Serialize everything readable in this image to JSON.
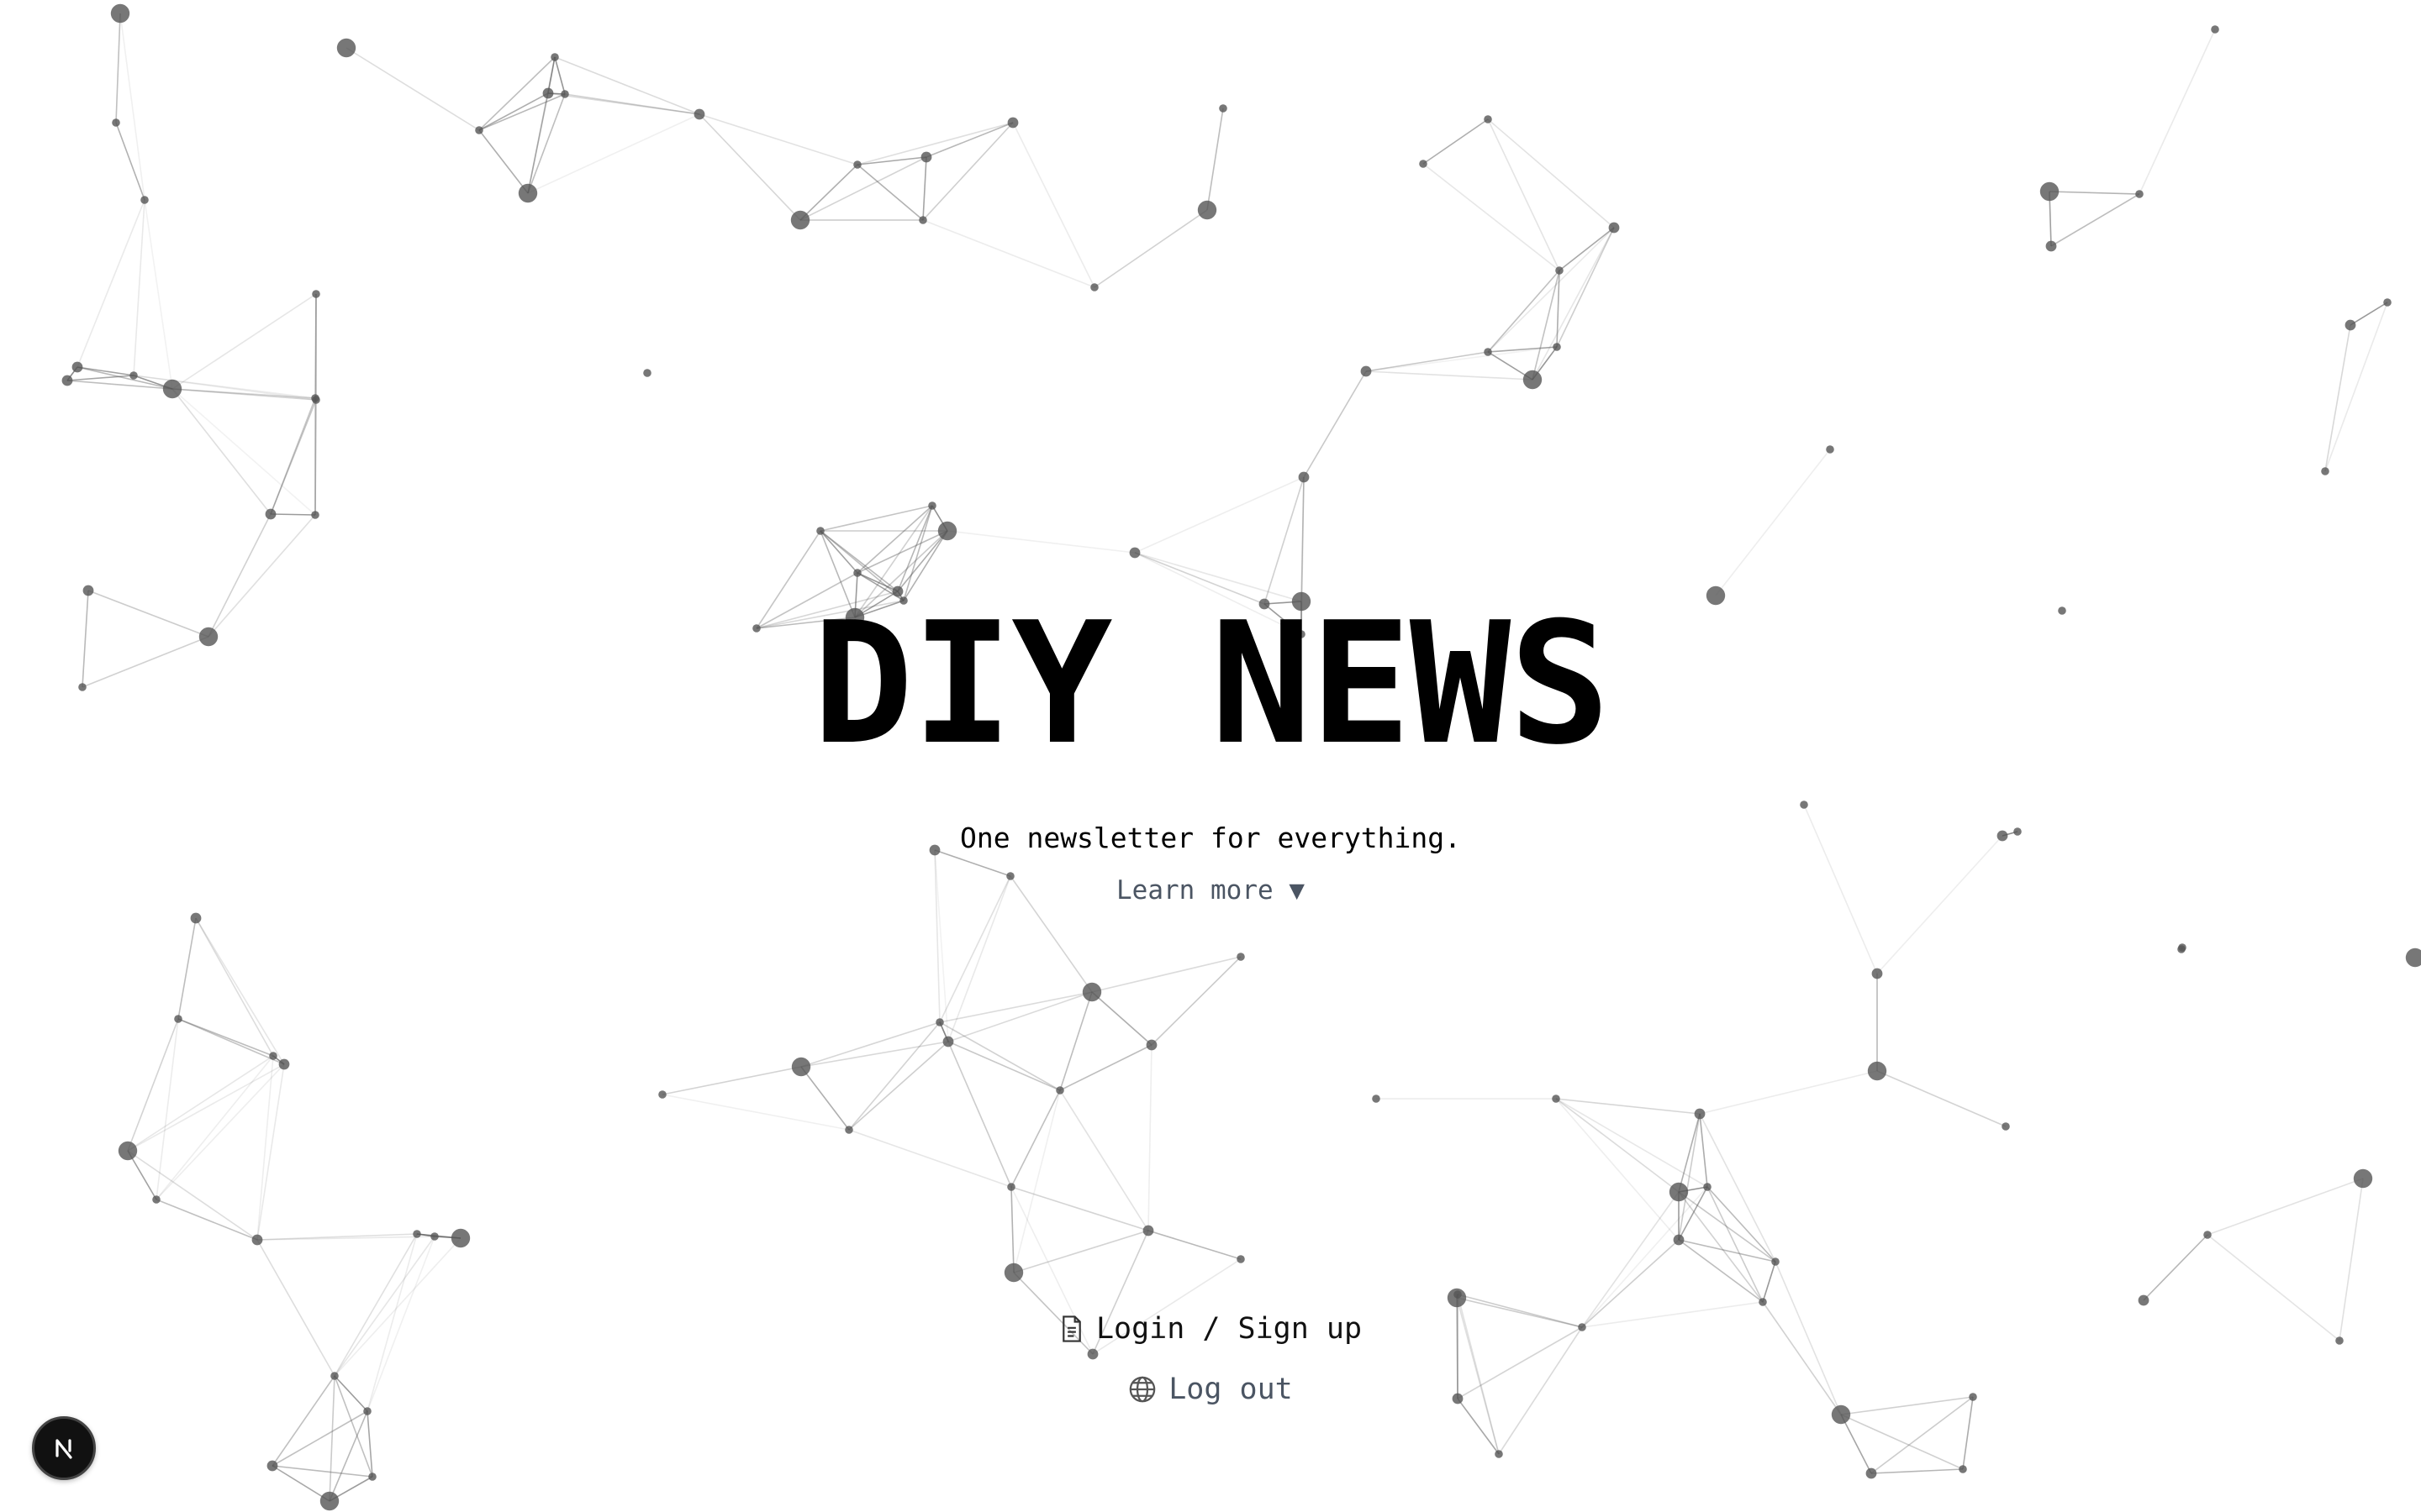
{
  "hero": {
    "title": "DIY NEWS",
    "subtitle": "One newsletter for everything.",
    "learn_more": "Learn more ▼"
  },
  "actions": {
    "login_label": "Login / Sign up",
    "logout_label": "Log out"
  },
  "icons": {
    "login": "document-icon",
    "logout": "globe-icon",
    "badge": "nextjs-logo-icon"
  },
  "colors": {
    "background": "#ffffff",
    "text": "#000000",
    "muted_text": "#4b5563",
    "network": "#555555"
  }
}
